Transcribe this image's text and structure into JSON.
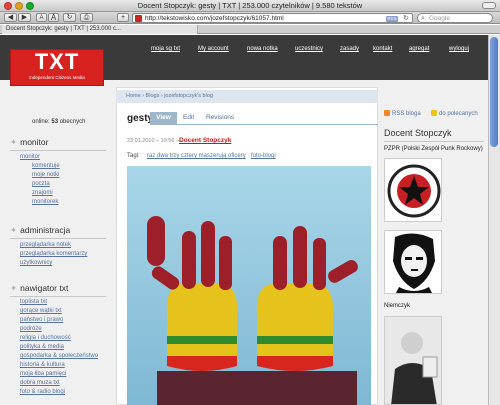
{
  "browser": {
    "window_title": "Docent Stopczyk: gesty | TXT | 253.000 czytelników | 9.580 tekstów",
    "url": "http://tekstowisko.com/jozefstopczyk/61057.html",
    "rss_badge": "RSS",
    "search_placeholder": "Google",
    "tab_title": "Docent Stopczyk: gesty | TXT | 253.000 c...",
    "buttons": {
      "back": "◀",
      "forward": "▶",
      "font_smaller": "A",
      "font_larger": "A",
      "add": "+"
    }
  },
  "site": {
    "logo_text": "TXT",
    "logo_sub": "Independent Citizens Media",
    "top_nav": [
      "moja sg txt",
      "My account",
      "nowa notka",
      "uczestnicy",
      "zasady",
      "kontakt",
      "agregat",
      "wyloguj"
    ]
  },
  "breadcrumb": "Home › Blogs › jozefstopczyk's blog",
  "post": {
    "title": "gesty",
    "tabs": {
      "view": "View",
      "edit": "Edit",
      "revisions": "Revisions"
    },
    "date": "23.01.2010 – 19:56 —",
    "author": "Docent Stopczyk",
    "tags_label": "Tagi:",
    "tags": [
      "raz dwa trzy cztery maszerują oficery",
      "foto-blogi"
    ]
  },
  "sidebar_left": {
    "online_prefix": "online:",
    "online_count": "53",
    "online_suffix": "obecnych",
    "blocks": [
      {
        "title": "monitor",
        "items": [
          "monitor",
          "komentuje",
          "moje notki",
          "poczta",
          "znajomi",
          "monitorek"
        ]
      },
      {
        "title": "administracja",
        "items": [
          "przeglądarka notek",
          "przeglądarka komentarzy",
          "użytkownicy"
        ]
      },
      {
        "title": "nawigator txt",
        "items": [
          "toplista txt",
          "gorące wątki txt",
          "państwo i prawo",
          "podróże",
          "religia i duchowość",
          "polityka & media",
          "gospodarka & społeczeństwo",
          "historia & kultura",
          "moja łiba pamięci",
          "dobra muza txt",
          "foto & radio blogi"
        ]
      }
    ]
  },
  "sidebar_right": {
    "rss_label": "RSS bloga",
    "fav_label": "do polecanych",
    "heading": "Docent Stopczyk",
    "subtitle": "PZPR (Polski Zespół Punk Rockowy)",
    "caption": "Niemczyk"
  },
  "colors": {
    "accent_red": "#c0161c",
    "link_blue": "#5573a0",
    "header_dark": "#3a3a3a",
    "logo_red": "#d8221f"
  },
  "icons": [
    "search-icon",
    "reload-icon",
    "rss-icon",
    "star-icon",
    "bookmark-icon"
  ]
}
